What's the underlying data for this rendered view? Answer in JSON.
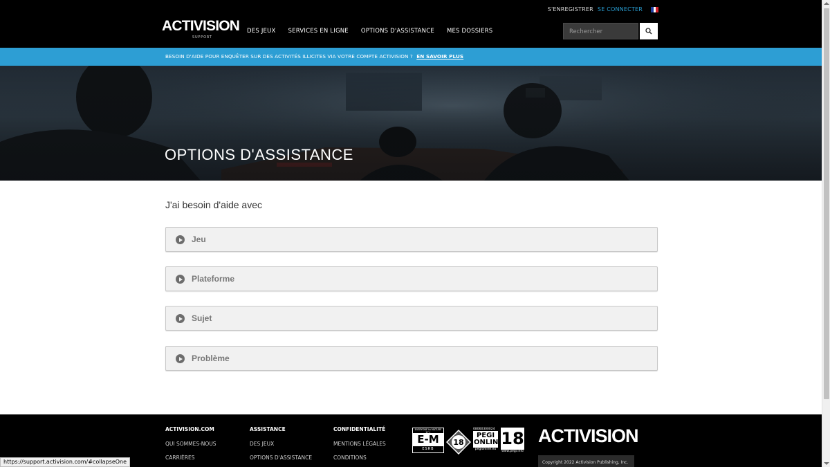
{
  "header": {
    "logo_text": "ACTIVISION",
    "logo_sub": "SUPPORT",
    "register_label": "S'ENREGISTRER",
    "login_label": "SE CONNECTER",
    "language_icon": "france-flag-icon",
    "nav": [
      "DES JEUX",
      "SERVICES EN LIGNE",
      "OPTIONS D'ASSISTANCE",
      "MES DOSSIERS"
    ],
    "search_placeholder": "Rechercher",
    "search_icon": "search-icon"
  },
  "banner": {
    "text": "BESOIN D'AIDE POUR ENQUÊTER SUR DES ACTIVITÉS ILLICITES VIA VOTRE COMPTE ACTIVISION ?",
    "link": "EN SAVOIR PLUS"
  },
  "hero": {
    "title": "OPTIONS D'ASSISTANCE"
  },
  "main": {
    "section_title": "J'ai besoin d'aide avec",
    "accordions": [
      "Jeu",
      "Plateforme",
      "Sujet",
      "Problème"
    ]
  },
  "footer": {
    "columns": [
      {
        "heading": "ACTIVISION.COM",
        "links": [
          "QUI SOMMES-NOUS",
          "CARRIÈRES"
        ]
      },
      {
        "heading": "ASSISTANCE",
        "links": [
          "DES JEUX",
          "OPTIONS D'ASSISTANCE"
        ]
      },
      {
        "heading": "CONFIDENTIALITÉ",
        "links": [
          "MENTIONS LÉGALES",
          "CONDITIONS"
        ]
      }
    ],
    "ratings": {
      "esrb_top": "EVERYONE to MATURE 17+",
      "esrb_mark": "E-M",
      "esrb_bottom": "ESRB",
      "usk": "18",
      "pegi_online_number": "08060300024",
      "pegi_online_text": "PEGI ONLINE",
      "pegi_online_url": "pegionline.eu",
      "pegi_rating": "18",
      "pegi_url": "www.pegi.info"
    },
    "logo_text": "ACTIVISION",
    "copyright": "Copyright 2022 Activision Publishing, Inc."
  },
  "status_bar": {
    "url": "https://support.activision.com/#collapseOne"
  },
  "colors": {
    "header_bg": "#000000",
    "banner_bg": "#2d9ed4",
    "link_blue": "#2aa1d6",
    "accordion_bg": "#f1f1f1"
  }
}
